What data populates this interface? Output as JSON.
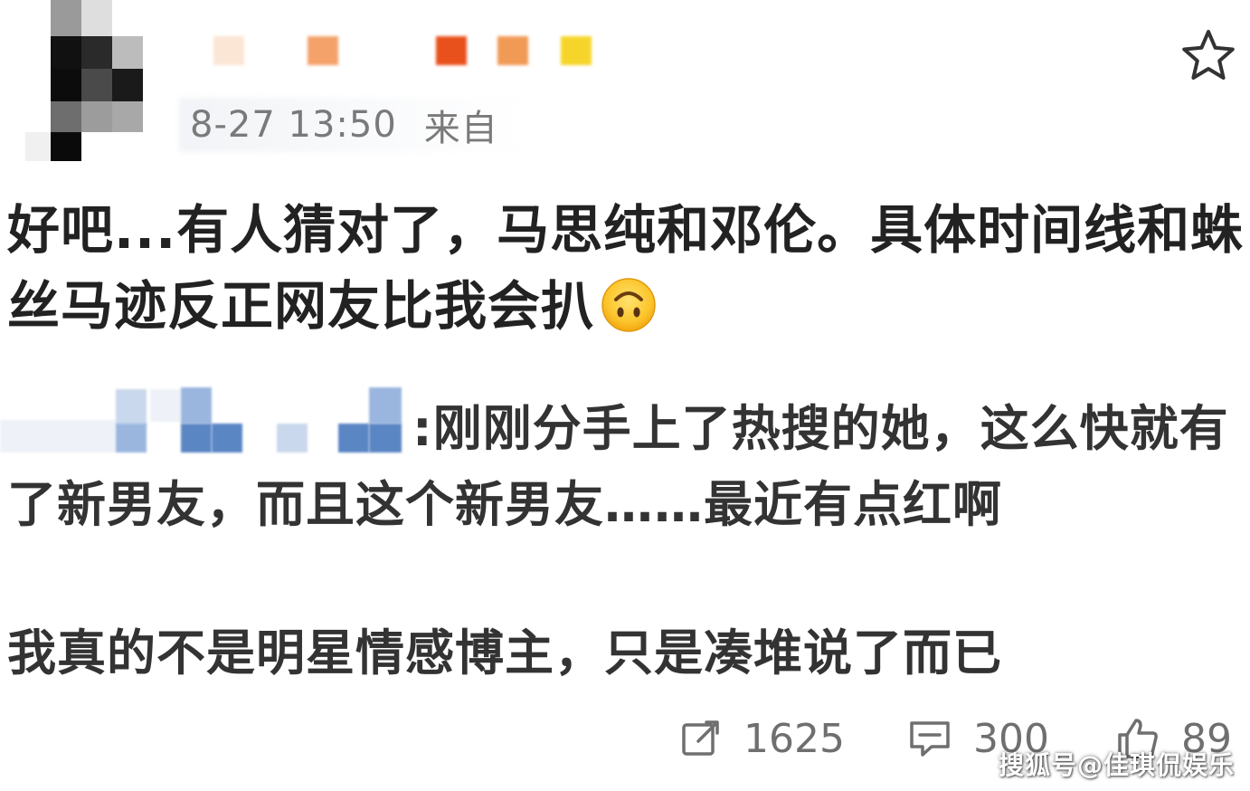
{
  "header": {
    "timestamp": "8-27 13:50",
    "source_label": "来自"
  },
  "post": {
    "text": "好吧...有人猜对了，马思纯和邓伦。具体时间线和蛛丝马迹反正网友比我会扒",
    "emoji": "upside-down-face"
  },
  "quote": {
    "text": ":刚刚分手上了热搜的她，这么快就有了新男友，而且这个新男友……最近有点红啊"
  },
  "note": {
    "text": "我真的不是明星情感博主，只是凑堆说了而已"
  },
  "actions": {
    "repost_count": "1625",
    "comment_count": "300",
    "like_count": "89"
  },
  "watermark": {
    "text": "搜狐号@佳琪侃娱乐"
  },
  "colors": {
    "text_primary": "#222222",
    "text_muted": "#7a7a7a",
    "icon": "#6f6f6f",
    "username_blocks": [
      "#fbe6d6",
      "#f4a26a",
      "#e8501c",
      "#f19a55",
      "#f6d52a"
    ],
    "quote_blocks": [
      "#5a86c4",
      "#9ab6de",
      "#c9d8ec"
    ]
  },
  "icons": {
    "favorite": "star-icon",
    "repost": "repost-icon",
    "comment": "comment-icon",
    "like": "thumbs-up-icon"
  }
}
